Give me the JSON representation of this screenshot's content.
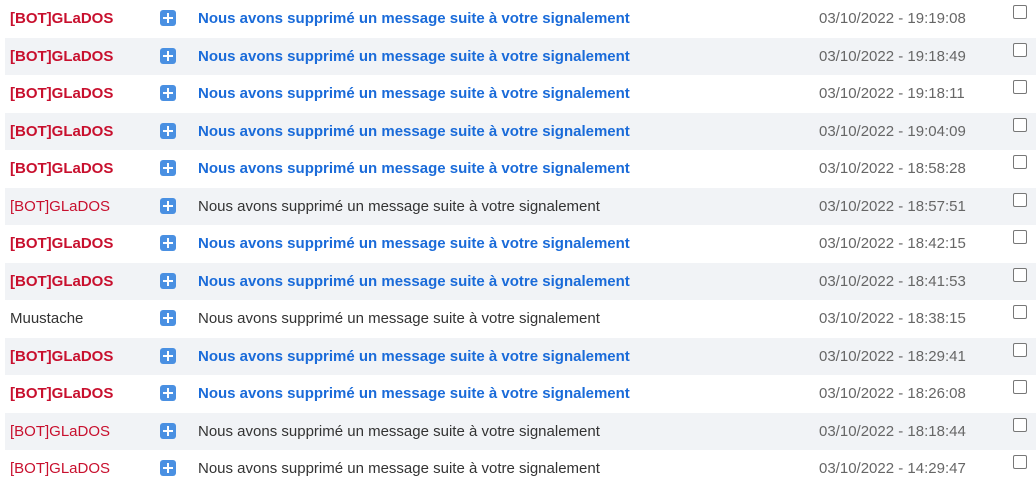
{
  "colors": {
    "bot_sender": "#c8102e",
    "unread_subject": "#1a6bd9",
    "read_text": "#333333",
    "date_text": "#666666",
    "row_alt_bg": "#f1f3f6",
    "plus_icon": "#4a90e2"
  },
  "messages": [
    {
      "sender": "[BOT]GLaDOS",
      "is_bot": true,
      "unread": true,
      "subject": "Nous avons supprimé un message suite à votre signalement",
      "date": "03/10/2022 - 19:19:08"
    },
    {
      "sender": "[BOT]GLaDOS",
      "is_bot": true,
      "unread": true,
      "subject": "Nous avons supprimé un message suite à votre signalement",
      "date": "03/10/2022 - 19:18:49"
    },
    {
      "sender": "[BOT]GLaDOS",
      "is_bot": true,
      "unread": true,
      "subject": "Nous avons supprimé un message suite à votre signalement",
      "date": "03/10/2022 - 19:18:11"
    },
    {
      "sender": "[BOT]GLaDOS",
      "is_bot": true,
      "unread": true,
      "subject": "Nous avons supprimé un message suite à votre signalement",
      "date": "03/10/2022 - 19:04:09"
    },
    {
      "sender": "[BOT]GLaDOS",
      "is_bot": true,
      "unread": true,
      "subject": "Nous avons supprimé un message suite à votre signalement",
      "date": "03/10/2022 - 18:58:28"
    },
    {
      "sender": "[BOT]GLaDOS",
      "is_bot": true,
      "unread": false,
      "subject": "Nous avons supprimé un message suite à votre signalement",
      "date": "03/10/2022 - 18:57:51"
    },
    {
      "sender": "[BOT]GLaDOS",
      "is_bot": true,
      "unread": true,
      "subject": "Nous avons supprimé un message suite à votre signalement",
      "date": "03/10/2022 - 18:42:15"
    },
    {
      "sender": "[BOT]GLaDOS",
      "is_bot": true,
      "unread": true,
      "subject": "Nous avons supprimé un message suite à votre signalement",
      "date": "03/10/2022 - 18:41:53"
    },
    {
      "sender": "Muustache",
      "is_bot": false,
      "unread": false,
      "subject": "Nous avons supprimé un message suite à votre signalement",
      "date": "03/10/2022 - 18:38:15"
    },
    {
      "sender": "[BOT]GLaDOS",
      "is_bot": true,
      "unread": true,
      "subject": "Nous avons supprimé un message suite à votre signalement",
      "date": "03/10/2022 - 18:29:41"
    },
    {
      "sender": "[BOT]GLaDOS",
      "is_bot": true,
      "unread": true,
      "subject": "Nous avons supprimé un message suite à votre signalement",
      "date": "03/10/2022 - 18:26:08"
    },
    {
      "sender": "[BOT]GLaDOS",
      "is_bot": true,
      "unread": false,
      "subject": "Nous avons supprimé un message suite à votre signalement",
      "date": "03/10/2022 - 18:18:44"
    },
    {
      "sender": "[BOT]GLaDOS",
      "is_bot": true,
      "unread": false,
      "subject": "Nous avons supprimé un message suite à votre signalement",
      "date": "03/10/2022 - 14:29:47"
    }
  ]
}
